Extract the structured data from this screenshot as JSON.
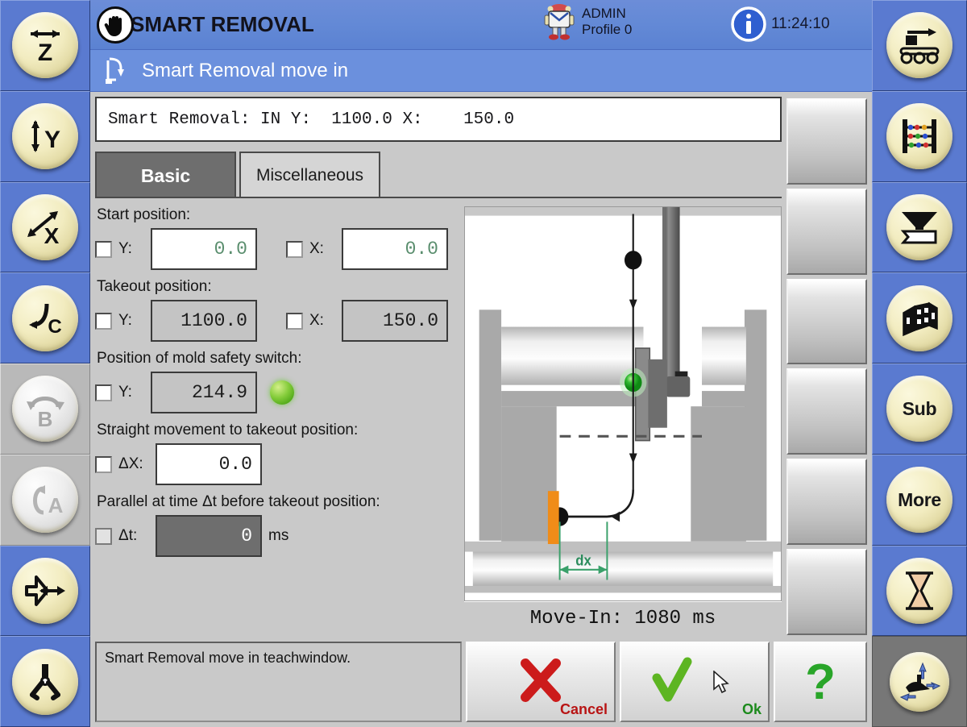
{
  "header": {
    "app_title": "SMART REMOVAL",
    "hand_icon": "hand-icon",
    "user_name": "ADMIN",
    "user_profile": "Profile 0",
    "robot_icon": "robot-icon",
    "info_icon": "info-icon",
    "clock": "11:24:10"
  },
  "window": {
    "icon": "move-in-path-icon",
    "title": "Smart Removal move in"
  },
  "status_line": "Smart Removal: IN Y:  1100.0 X:    150.0",
  "tabs": [
    {
      "label": "Basic",
      "active": true
    },
    {
      "label": "Miscellaneous",
      "active": false
    }
  ],
  "form": {
    "groups": [
      {
        "label": "Start position:",
        "fields": [
          {
            "label": "Y:",
            "value": "0.0",
            "style": "white-green",
            "checked": false
          },
          {
            "label": "X:",
            "value": "0.0",
            "style": "white-green",
            "checked": false
          }
        ]
      },
      {
        "label": "Takeout position:",
        "fields": [
          {
            "label": "Y:",
            "value": "1100.0",
            "style": "grey",
            "checked": false
          },
          {
            "label": "X:",
            "value": "150.0",
            "style": "grey",
            "checked": false
          }
        ]
      },
      {
        "label": "Position of mold safety switch:",
        "fields": [
          {
            "label": "Y:",
            "value": "214.9",
            "style": "grey",
            "checked": false
          }
        ],
        "led": "status-led-green"
      },
      {
        "label": "Straight movement to takeout position:",
        "fields": [
          {
            "label": "ΔX:",
            "value": "0.0",
            "style": "white",
            "checked": false
          }
        ]
      },
      {
        "label": "Parallel at time Δt before takeout position:",
        "fields": [
          {
            "label": "Δt:",
            "value": "0",
            "style": "dark",
            "checked": false,
            "unit": "ms"
          }
        ]
      }
    ]
  },
  "graphic": {
    "dimension_label": "dx",
    "path_color": "#1a1a1a",
    "dimension_color": "#3aa06a",
    "part_color": "#f08c18",
    "sensor_color": "#1faa3c"
  },
  "movein": "Move-In: 1080 ms",
  "bottom": {
    "message": "Smart Removal move in teachwindow.",
    "cancel_label": "Cancel",
    "cancel_icon": "red-x-icon",
    "ok_label": "Ok",
    "ok_icon": "green-check-icon",
    "help_icon": "green-question-mark-icon",
    "cursor_icon": "mouse-cursor-icon"
  },
  "left_sidebar": [
    {
      "name": "axis-z-button",
      "icon": "axis-z-horizontal-arrow-icon",
      "text": "Z",
      "disabled": false
    },
    {
      "name": "axis-y-button",
      "icon": "axis-y-vertical-arrow-icon",
      "text": "Y",
      "disabled": false
    },
    {
      "name": "axis-x-button",
      "icon": "axis-x-diagonal-arrow-icon",
      "text": "X",
      "disabled": false
    },
    {
      "name": "axis-c-button",
      "icon": "axis-c-rotate-arrow-icon",
      "text": "C",
      "disabled": false
    },
    {
      "name": "axis-b-button",
      "icon": "axis-b-rotate-arrow-icon",
      "text": "B",
      "disabled": true
    },
    {
      "name": "axis-a-button",
      "icon": "axis-a-rotate-arrow-icon",
      "text": "A",
      "disabled": true
    },
    {
      "name": "kinematics-button",
      "icon": "arrow-flag-move-icon",
      "text": "",
      "disabled": false
    },
    {
      "name": "gripper-button",
      "icon": "gripper-icon",
      "text": "",
      "disabled": false
    }
  ],
  "right_sidebar": [
    {
      "name": "conveyor-button",
      "icon": "conveyor-belt-icon",
      "text": "",
      "disabled": false,
      "selected": false
    },
    {
      "name": "counter-button",
      "icon": "abacus-icon",
      "text": "",
      "disabled": false,
      "selected": false
    },
    {
      "name": "hopper-button",
      "icon": "funnel-icon",
      "text": "",
      "disabled": false,
      "selected": false
    },
    {
      "name": "stacking-button",
      "icon": "stacking-cubes-icon",
      "text": "",
      "disabled": false,
      "selected": false
    },
    {
      "name": "sub-button",
      "icon": "",
      "text": "Sub",
      "disabled": false,
      "selected": false
    },
    {
      "name": "more-button",
      "icon": "",
      "text": "More",
      "disabled": false,
      "selected": false
    },
    {
      "name": "wait-button",
      "icon": "hourglass-icon",
      "text": "",
      "disabled": false,
      "selected": false
    },
    {
      "name": "teach-button",
      "icon": "teach-axes-icon",
      "text": "",
      "disabled": false,
      "selected": true
    }
  ],
  "softkeys": [
    {
      "label": ""
    },
    {
      "label": ""
    },
    {
      "label": ""
    },
    {
      "label": ""
    },
    {
      "label": ""
    },
    {
      "label": ""
    }
  ]
}
